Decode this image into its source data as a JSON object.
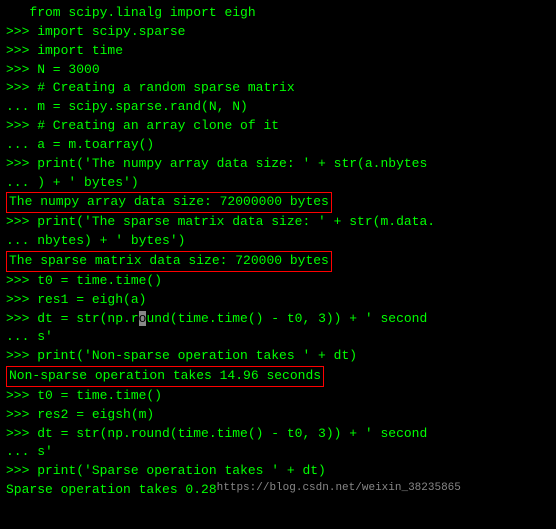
{
  "terminal": {
    "lines": [
      {
        "type": "code",
        "prompt": "   ",
        "text": "from scipy.linalg import eigh"
      },
      {
        "type": "code",
        "prompt": ">>>",
        "text": " import scipy.sparse"
      },
      {
        "type": "code",
        "prompt": ">>>",
        "text": " import time"
      },
      {
        "type": "code",
        "prompt": ">>>",
        "text": " N = 3000"
      },
      {
        "type": "code",
        "prompt": ">>>",
        "text": " # Creating a random sparse matrix"
      },
      {
        "type": "code",
        "prompt": "...",
        "text": " m = scipy.sparse.rand(N, N)"
      },
      {
        "type": "code",
        "prompt": ">>>",
        "text": " # Creating an array clone of it"
      },
      {
        "type": "code",
        "prompt": "...",
        "text": " a = m.toarray()"
      },
      {
        "type": "code",
        "prompt": ">>>",
        "text": " print('The numpy array data size: ' + str(a.nbytes"
      },
      {
        "type": "code",
        "prompt": "...",
        "text": " ) + ' bytes')"
      },
      {
        "type": "output-box",
        "text": "The numpy array data size: 72000000 bytes"
      },
      {
        "type": "code",
        "prompt": ">>>",
        "text": " print('The sparse matrix data size: ' + str(m.data."
      },
      {
        "type": "code",
        "prompt": "...",
        "text": " nbytes) + ' bytes')"
      },
      {
        "type": "output-box",
        "text": "The sparse matrix data size: 720000 bytes"
      },
      {
        "type": "code",
        "prompt": ">>>",
        "text": " t0 = time.time()"
      },
      {
        "type": "code",
        "prompt": ">>>",
        "text": " res1 = eigh(a)"
      },
      {
        "type": "code",
        "prompt": ">>>",
        "text": " dt = str(np.round(time.time() - t0, 3)) + ' second"
      },
      {
        "type": "code",
        "prompt": "...",
        "text": " s'"
      },
      {
        "type": "code",
        "prompt": ">>>",
        "text": " print('Non-sparse operation takes ' + dt)"
      },
      {
        "type": "output-box",
        "text": "Non-sparse operation takes 14.96 seconds"
      },
      {
        "type": "code",
        "prompt": ">>>",
        "text": " t0 = time.time()"
      },
      {
        "type": "code",
        "prompt": ">>>",
        "text": " res2 = eigsh(m)"
      },
      {
        "type": "code",
        "prompt": ">>>",
        "text": " dt = str(np.round(time.time() - t0, 3)) + ' second"
      },
      {
        "type": "code",
        "prompt": "...",
        "text": " s'"
      },
      {
        "type": "code",
        "prompt": ">>>",
        "text": " print('Sparse operation takes ' + dt)"
      },
      {
        "type": "output-partial",
        "text": "Sparse operation takes 0.28"
      }
    ]
  },
  "watermark": "https://blog.csdn.net/weixin_38235865"
}
